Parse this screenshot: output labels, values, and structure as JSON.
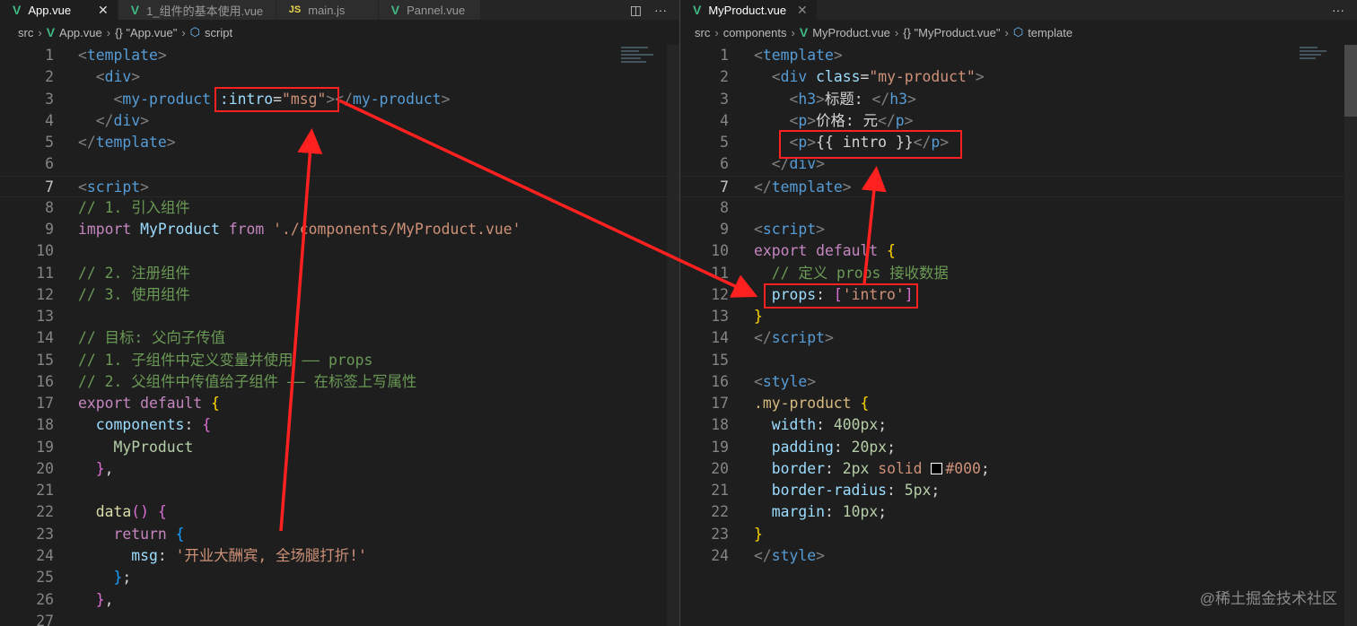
{
  "left_editor": {
    "tabs": [
      {
        "label": "App.vue",
        "icon": "vue-icon",
        "active": true
      },
      {
        "label": "1_组件的基本使用.vue",
        "icon": "vue-icon"
      },
      {
        "label": "main.js",
        "icon": "js-icon",
        "icon_text": "JS"
      },
      {
        "label": "Pannel.vue",
        "icon": "vue-icon"
      }
    ],
    "close_glyph": "✕",
    "split_glyph": "◫",
    "more_glyph": "···",
    "breadcrumb": [
      "src",
      "App.vue",
      "{} \"App.vue\"",
      "script"
    ],
    "current_line": 7,
    "lines": [
      [
        [
          "p",
          "<"
        ],
        [
          "t",
          "template"
        ],
        [
          "p",
          ">"
        ]
      ],
      [
        [
          "w",
          "  "
        ],
        [
          "p",
          "<"
        ],
        [
          "t",
          "div"
        ],
        [
          "p",
          ">"
        ]
      ],
      [
        [
          "w",
          "    "
        ],
        [
          "p",
          "<"
        ],
        [
          "t",
          "my-product"
        ],
        [
          "w",
          " "
        ],
        [
          "a",
          ":intro"
        ],
        [
          "w",
          "="
        ],
        [
          "s",
          "\"msg\""
        ],
        [
          "p",
          "></"
        ],
        [
          "t",
          "my-product"
        ],
        [
          "p",
          ">"
        ]
      ],
      [
        [
          "w",
          "  "
        ],
        [
          "p",
          "</"
        ],
        [
          "t",
          "div"
        ],
        [
          "p",
          ">"
        ]
      ],
      [
        [
          "p",
          "</"
        ],
        [
          "t",
          "template"
        ],
        [
          "p",
          ">"
        ]
      ],
      [],
      [
        [
          "p",
          "<"
        ],
        [
          "t",
          "script"
        ],
        [
          "p",
          ">"
        ]
      ],
      [
        [
          "c",
          "// 1. 引入组件"
        ]
      ],
      [
        [
          "k",
          "import"
        ],
        [
          "w",
          " "
        ],
        [
          "v",
          "MyProduct"
        ],
        [
          "w",
          " "
        ],
        [
          "k",
          "from"
        ],
        [
          "w",
          " "
        ],
        [
          "s",
          "'./components/MyProduct.vue'"
        ]
      ],
      [],
      [
        [
          "c",
          "// 2. 注册组件"
        ]
      ],
      [
        [
          "c",
          "// 3. 使用组件"
        ]
      ],
      [],
      [
        [
          "c",
          "// 目标: 父向子传值"
        ]
      ],
      [
        [
          "c",
          "// 1. 子组件中定义变量并使用 —— props"
        ]
      ],
      [
        [
          "c",
          "// 2. 父组件中传值给子组件 —— 在标签上写属性"
        ]
      ],
      [
        [
          "k",
          "export"
        ],
        [
          "w",
          " "
        ],
        [
          "k",
          "default"
        ],
        [
          "w",
          " "
        ],
        [
          "y",
          "{"
        ]
      ],
      [
        [
          "w",
          "  "
        ],
        [
          "v",
          "components"
        ],
        [
          "w",
          ": "
        ],
        [
          "m",
          "{"
        ]
      ],
      [
        [
          "w",
          "    "
        ],
        [
          "n",
          "MyProduct"
        ]
      ],
      [
        [
          "w",
          "  "
        ],
        [
          "m",
          "}"
        ],
        [
          "w",
          ","
        ]
      ],
      [],
      [
        [
          "w",
          "  "
        ],
        [
          "f",
          "data"
        ],
        [
          "m",
          "()"
        ],
        [
          "w",
          " "
        ],
        [
          "m",
          "{"
        ]
      ],
      [
        [
          "w",
          "    "
        ],
        [
          "k",
          "return"
        ],
        [
          "w",
          " "
        ],
        [
          "b",
          "{"
        ]
      ],
      [
        [
          "w",
          "      "
        ],
        [
          "v",
          "msg"
        ],
        [
          "w",
          ": "
        ],
        [
          "s",
          "'开业大酬宾, 全场腿打折!'"
        ]
      ],
      [
        [
          "w",
          "    "
        ],
        [
          "b",
          "}"
        ],
        [
          "w",
          ";"
        ]
      ],
      [
        [
          "w",
          "  "
        ],
        [
          "m",
          "}"
        ],
        [
          "w",
          ","
        ]
      ],
      []
    ]
  },
  "right_editor": {
    "tabs": [
      {
        "label": "MyProduct.vue",
        "icon": "vue-icon",
        "active": true
      }
    ],
    "close_glyph": "✕",
    "more_glyph": "···",
    "breadcrumb": [
      "src",
      "components",
      "MyProduct.vue",
      "{} \"MyProduct.vue\"",
      "template"
    ],
    "current_line": 7,
    "lines": [
      [
        [
          "p",
          "<"
        ],
        [
          "t",
          "template"
        ],
        [
          "p",
          ">"
        ]
      ],
      [
        [
          "w",
          "  "
        ],
        [
          "p",
          "<"
        ],
        [
          "t",
          "div"
        ],
        [
          "w",
          " "
        ],
        [
          "a",
          "class"
        ],
        [
          "w",
          "="
        ],
        [
          "s",
          "\"my-product\""
        ],
        [
          "p",
          ">"
        ]
      ],
      [
        [
          "w",
          "    "
        ],
        [
          "p",
          "<"
        ],
        [
          "t",
          "h3"
        ],
        [
          "p",
          ">"
        ],
        [
          "w",
          "标题: "
        ],
        [
          "p",
          "</"
        ],
        [
          "t",
          "h3"
        ],
        [
          "p",
          ">"
        ]
      ],
      [
        [
          "w",
          "    "
        ],
        [
          "p",
          "<"
        ],
        [
          "t",
          "p"
        ],
        [
          "p",
          ">"
        ],
        [
          "w",
          "价格: 元"
        ],
        [
          "p",
          "</"
        ],
        [
          "t",
          "p"
        ],
        [
          "p",
          ">"
        ]
      ],
      [
        [
          "w",
          "    "
        ],
        [
          "p",
          "<"
        ],
        [
          "t",
          "p"
        ],
        [
          "p",
          ">"
        ],
        [
          "w",
          "{{ intro }}"
        ],
        [
          "p",
          "</"
        ],
        [
          "t",
          "p"
        ],
        [
          "p",
          ">"
        ]
      ],
      [
        [
          "w",
          "  "
        ],
        [
          "p",
          "</"
        ],
        [
          "t",
          "div"
        ],
        [
          "p",
          ">"
        ]
      ],
      [
        [
          "p",
          "</"
        ],
        [
          "t",
          "template"
        ],
        [
          "p",
          ">"
        ]
      ],
      [],
      [
        [
          "p",
          "<"
        ],
        [
          "t",
          "script"
        ],
        [
          "p",
          ">"
        ]
      ],
      [
        [
          "k",
          "export"
        ],
        [
          "w",
          " "
        ],
        [
          "k",
          "default"
        ],
        [
          "w",
          " "
        ],
        [
          "y",
          "{"
        ]
      ],
      [
        [
          "w",
          "  "
        ],
        [
          "c",
          "// 定义 props 接收数据"
        ]
      ],
      [
        [
          "w",
          "  "
        ],
        [
          "v",
          "props"
        ],
        [
          "w",
          ": "
        ],
        [
          "m",
          "["
        ],
        [
          "s",
          "'intro'"
        ],
        [
          "m",
          "]"
        ]
      ],
      [
        [
          "y",
          "}"
        ]
      ],
      [
        [
          "p",
          "</"
        ],
        [
          "t",
          "script"
        ],
        [
          "p",
          ">"
        ]
      ],
      [],
      [
        [
          "p",
          "<"
        ],
        [
          "t",
          "style"
        ],
        [
          "p",
          ">"
        ]
      ],
      [
        [
          "sel",
          ".my-product"
        ],
        [
          "w",
          " "
        ],
        [
          "y",
          "{"
        ]
      ],
      [
        [
          "w",
          "  "
        ],
        [
          "v",
          "width"
        ],
        [
          "w",
          ": "
        ],
        [
          "n",
          "400px"
        ],
        [
          "w",
          ";"
        ]
      ],
      [
        [
          "w",
          "  "
        ],
        [
          "v",
          "padding"
        ],
        [
          "w",
          ": "
        ],
        [
          "n",
          "20px"
        ],
        [
          "w",
          ";"
        ]
      ],
      [
        [
          "w",
          "  "
        ],
        [
          "v",
          "border"
        ],
        [
          "w",
          ": "
        ],
        [
          "n",
          "2px"
        ],
        [
          "w",
          " "
        ],
        [
          "s",
          "solid"
        ],
        [
          "w",
          " "
        ],
        [
          "swatch",
          ""
        ],
        [
          "s",
          "#000"
        ],
        [
          "w",
          ";"
        ]
      ],
      [
        [
          "w",
          "  "
        ],
        [
          "v",
          "border-radius"
        ],
        [
          "w",
          ": "
        ],
        [
          "n",
          "5px"
        ],
        [
          "w",
          ";"
        ]
      ],
      [
        [
          "w",
          "  "
        ],
        [
          "v",
          "margin"
        ],
        [
          "w",
          ": "
        ],
        [
          "n",
          "10px"
        ],
        [
          "w",
          ";"
        ]
      ],
      [
        [
          "y",
          "}"
        ]
      ],
      [
        [
          "p",
          "</"
        ],
        [
          "t",
          "style"
        ],
        [
          "p",
          ">"
        ]
      ]
    ]
  },
  "annotation_color": "#ff2020",
  "watermark": "@稀土掘金技术社区"
}
